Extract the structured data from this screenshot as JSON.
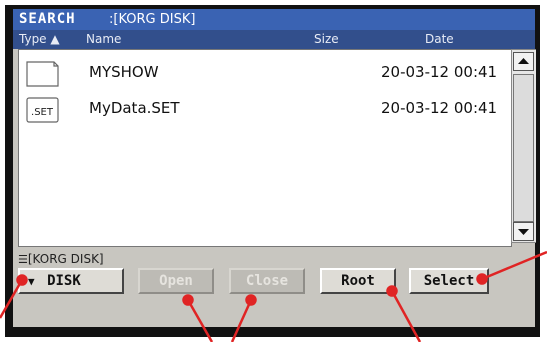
{
  "window": {
    "title_prefix": "SEARCH",
    "title_device": ":[KORG DISK]"
  },
  "columns": {
    "type": "Type",
    "sort_indicator": "▲",
    "name": "Name",
    "size": "Size",
    "date": "Date"
  },
  "files": [
    {
      "icon": "folder-icon",
      "icon_label": "",
      "name": "MYSHOW",
      "size": "",
      "date": "20-03-12 00:41"
    },
    {
      "icon": "set-file-icon",
      "icon_label": ".SET",
      "name": "MyData.SET",
      "size": "",
      "date": "20-03-12 00:41"
    }
  ],
  "path": "[KORG DISK]",
  "buttons": {
    "device": {
      "label": "DISK",
      "arrow": "▼",
      "enabled": true
    },
    "open": {
      "label": "Open",
      "enabled": false
    },
    "close": {
      "label": "Close",
      "enabled": false
    },
    "root": {
      "label": "Root",
      "enabled": true
    },
    "select": {
      "label": "Select",
      "enabled": true
    }
  },
  "colors": {
    "title_bar": "#3a63b3",
    "header_bar": "#324f8c",
    "panel": "#c8c6c0",
    "callout": "#e02424"
  }
}
